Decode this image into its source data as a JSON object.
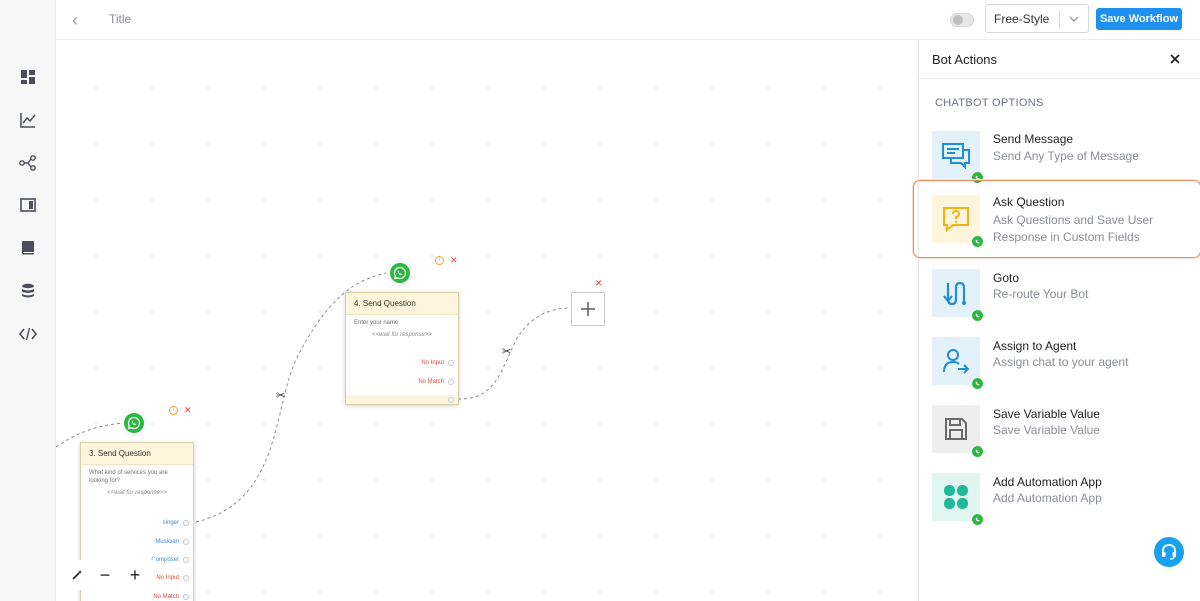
{
  "header": {
    "title": "Title",
    "mode_select": "Free-Style",
    "save_label": "Save Workflow",
    "toggle_on": false
  },
  "rail": {
    "items": [
      "dashboard-icon",
      "analytics-icon",
      "workflow-icon",
      "inbox-icon",
      "bookmark-icon",
      "database-icon",
      "code-icon"
    ]
  },
  "canvas": {
    "node3": {
      "title": "3. Send Question",
      "prompt": "What kind of services you are looking for?",
      "wait": "<<wait for response>>",
      "options": [
        "singer",
        "Musician",
        "Composer",
        "No Input",
        "No Match"
      ]
    },
    "node4": {
      "title": "4. Send Question",
      "prompt": "Enter your name",
      "wait": "<<wait for response>>",
      "options": [
        "No Input",
        "No Match"
      ]
    },
    "info_glyph": "i",
    "delete_glyph": "✕",
    "cut_glyph": "✂",
    "zoom": {
      "magic": "magic-wand-icon",
      "minus": "−",
      "plus": "+"
    }
  },
  "panel": {
    "title": "Bot Actions",
    "section": "CHATBOT OPTIONS",
    "actions": [
      {
        "name": "Send Message",
        "desc": "Send Any Type of Message",
        "icon": "chat-icon",
        "bg": "#e3f1fb",
        "color": "#1f8fd8"
      },
      {
        "name": "Ask Question",
        "desc": "Ask Questions and Save User Response in Custom Fields",
        "icon": "question-chat-icon",
        "bg": "#fff4dc",
        "color": "#f2b21b"
      },
      {
        "name": "Goto",
        "desc": "Re-route Your Bot",
        "icon": "route-icon",
        "bg": "#e3f1fb",
        "color": "#1f8fd8"
      },
      {
        "name": "Assign to Agent",
        "desc": "Assign chat to your agent",
        "icon": "agent-icon",
        "bg": "#e3f1fb",
        "color": "#1f8fd8"
      },
      {
        "name": "Save Variable Value",
        "desc": "Save Variable Value",
        "icon": "save-icon",
        "bg": "#eeeeee",
        "color": "#6b6b6b"
      },
      {
        "name": "Add Automation App",
        "desc": "Add Automation App",
        "icon": "apps-icon",
        "bg": "#e2f6f1",
        "color": "#1fb898"
      }
    ],
    "highlighted": "Ask Question"
  },
  "colors": {
    "accent": "#1e90f0",
    "whatsapp": "#2cb742",
    "highlight_border": "#ef8a5c",
    "danger": "#e54b3f"
  }
}
